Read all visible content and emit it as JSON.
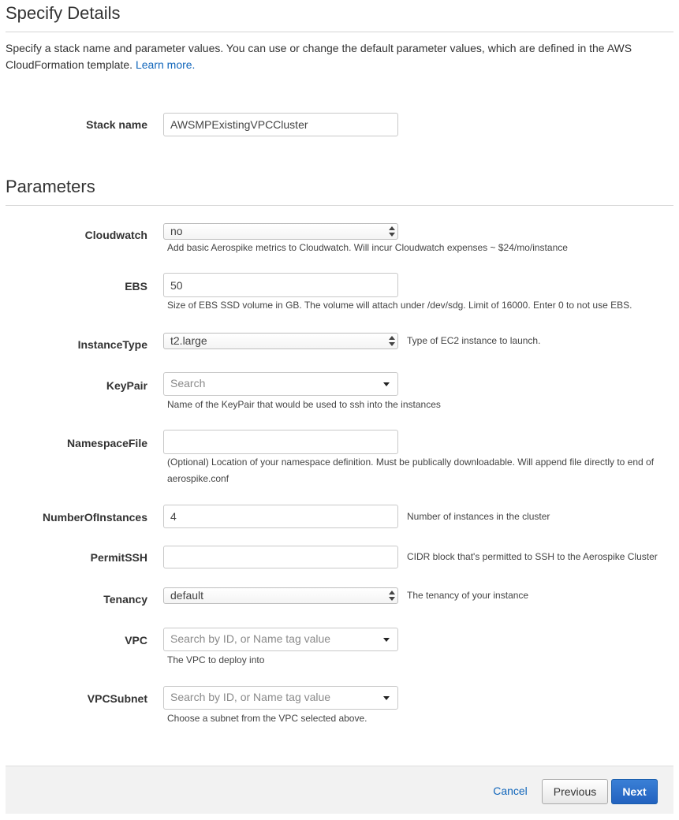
{
  "specify": {
    "title": "Specify Details",
    "intro": "Specify a stack name and parameter values. You can use or change the default parameter values, which are defined in the AWS CloudFormation template.",
    "learn_more": "Learn more."
  },
  "stack": {
    "label": "Stack name",
    "value": "AWSMPExistingVPCCluster"
  },
  "parameters": {
    "title": "Parameters",
    "cloudwatch": {
      "label": "Cloudwatch",
      "value": "no",
      "help": "Add basic Aerospike metrics to Cloudwatch. Will incur Cloudwatch expenses ~ $24/mo/instance"
    },
    "ebs": {
      "label": "EBS",
      "value": "50",
      "help": "Size of EBS SSD volume in GB. The volume will attach under /dev/sdg. Limit of 16000. Enter 0 to not use EBS."
    },
    "instance_type": {
      "label": "InstanceType",
      "value": "t2.large",
      "help": "Type of EC2 instance to launch."
    },
    "keypair": {
      "label": "KeyPair",
      "placeholder": "Search",
      "help": "Name of the KeyPair that would be used to ssh into the instances"
    },
    "namespace_file": {
      "label": "NamespaceFile",
      "value": "",
      "help_line1": "(Optional) Location of your namespace definition. Must be publically downloadable. Will append file directly to end of",
      "help_line2": "aerospike.conf"
    },
    "number_of_instances": {
      "label": "NumberOfInstances",
      "value": "4",
      "help": "Number of instances in the cluster"
    },
    "permit_ssh": {
      "label": "PermitSSH",
      "value": "",
      "help": "CIDR block that's permitted to SSH to the Aerospike Cluster"
    },
    "tenancy": {
      "label": "Tenancy",
      "value": "default",
      "help": "The tenancy of your instance"
    },
    "vpc": {
      "label": "VPC",
      "placeholder": "Search by ID, or Name tag value",
      "help": "The VPC to deploy into"
    },
    "vpc_subnet": {
      "label": "VPCSubnet",
      "placeholder": "Search by ID, or Name tag value",
      "help": "Choose a subnet from the VPC selected above."
    }
  },
  "footer": {
    "cancel": "Cancel",
    "previous": "Previous",
    "next": "Next"
  },
  "colors": {
    "link": "#1166bb",
    "primary": "#2262bf"
  }
}
